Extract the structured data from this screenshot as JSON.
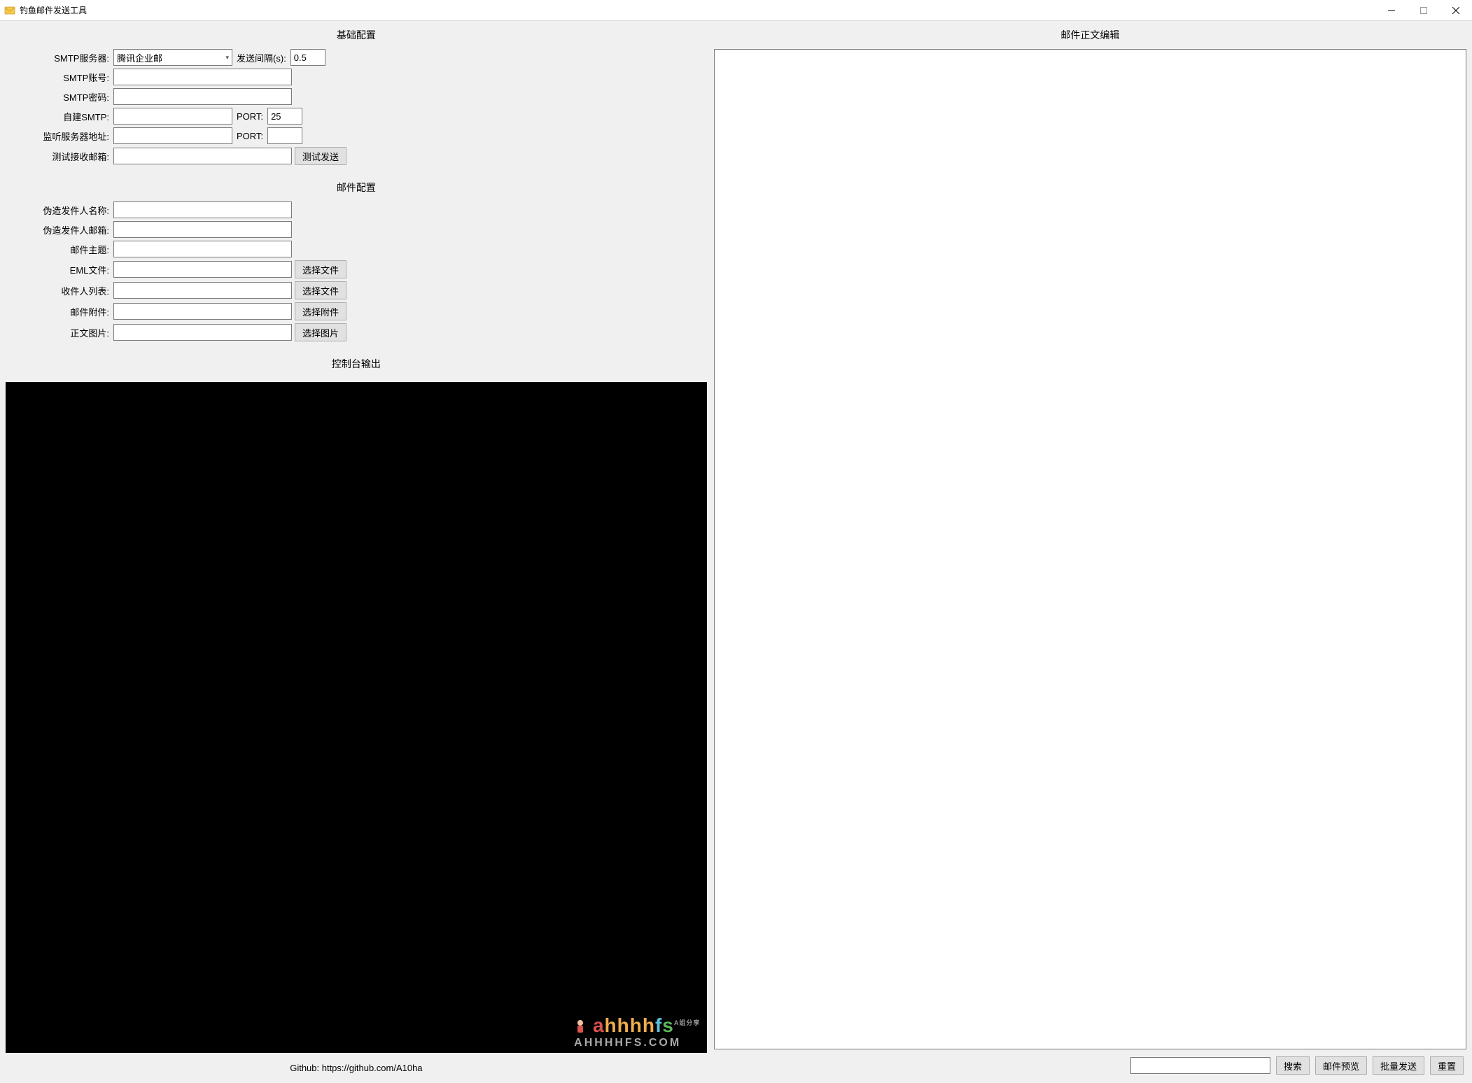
{
  "window": {
    "title": "钓鱼邮件发送工具"
  },
  "sections": {
    "basic": "基础配置",
    "mail": "邮件配置",
    "console": "控制台输出",
    "editor": "邮件正文编辑"
  },
  "basic": {
    "smtp_server_label": "SMTP服务器:",
    "smtp_server_value": "腾讯企业邮",
    "interval_label": "发送间隔(s):",
    "interval_value": "0.5",
    "smtp_account_label": "SMTP账号:",
    "smtp_account_value": "",
    "smtp_password_label": "SMTP密码:",
    "smtp_password_value": "",
    "custom_smtp_label": "自建SMTP:",
    "custom_smtp_value": "",
    "port1_label": "PORT:",
    "port1_value": "25",
    "listen_label": "监听服务器地址:",
    "listen_value": "",
    "port2_label": "PORT:",
    "port2_value": "",
    "test_recv_label": "测试接收邮箱:",
    "test_recv_value": "",
    "test_send_btn": "测试发送"
  },
  "mail": {
    "fake_name_label": "伪造发件人名称:",
    "fake_name_value": "",
    "fake_email_label": "伪造发件人邮箱:",
    "fake_email_value": "",
    "subject_label": "邮件主题:",
    "subject_value": "",
    "eml_label": "EML文件:",
    "eml_value": "",
    "eml_btn": "选择文件",
    "recipients_label": "收件人列表:",
    "recipients_value": "",
    "recipients_btn": "选择文件",
    "attachment_label": "邮件附件:",
    "attachment_value": "",
    "attachment_btn": "选择附件",
    "body_image_label": "正文图片:",
    "body_image_value": "",
    "body_image_btn": "选择图片"
  },
  "footer": {
    "github": "Github: https://github.com/A10ha"
  },
  "bottom": {
    "search_value": "",
    "search_btn": "搜索",
    "preview_btn": "邮件预览",
    "batch_send_btn": "批量发送",
    "reset_btn": "重置"
  },
  "watermark": {
    "text": "ahhhhfs",
    "sub": "AHHHHFS.COM",
    "tag": "A姐分享"
  }
}
